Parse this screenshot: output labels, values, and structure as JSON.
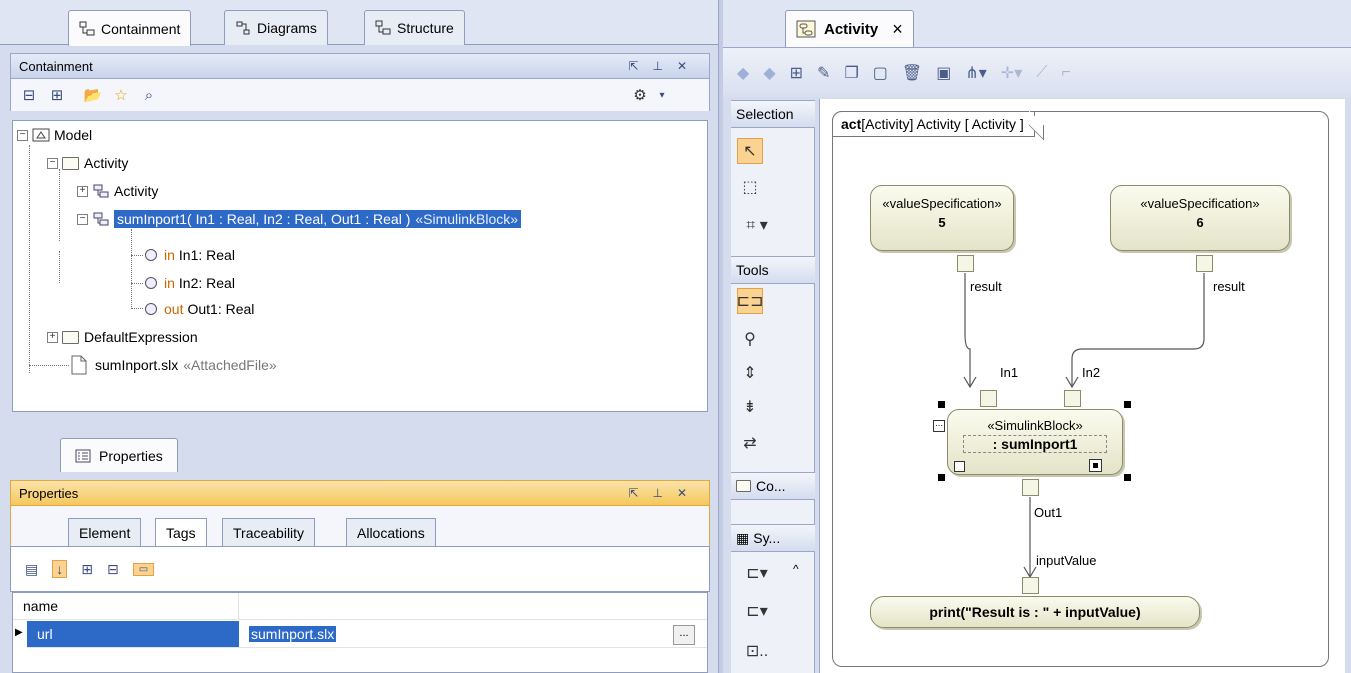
{
  "left_tabs": [
    {
      "label": "Containment",
      "active": true
    },
    {
      "label": "Diagrams",
      "active": false
    },
    {
      "label": "Structure",
      "active": false
    }
  ],
  "containment": {
    "title": "Containment",
    "tree": {
      "model": "Model",
      "activity_pkg": "Activity",
      "activity_item": "Activity",
      "sum_block": "sumInport1( In1 : Real, In2 : Real, Out1 : Real )",
      "sum_block_stereo": "«SimulinkBlock»",
      "params": [
        {
          "dir": "in",
          "name": "In1",
          "type": " : Real"
        },
        {
          "dir": "in",
          "name": "In2",
          "type": " : Real"
        },
        {
          "dir": "out",
          "name": "Out1",
          "type": " : Real"
        }
      ],
      "default_expr": "DefaultExpression",
      "file": "sumInport.slx",
      "file_stereo": "«AttachedFile»"
    }
  },
  "properties": {
    "tab_label": "Properties",
    "title": "Properties",
    "subtabs": [
      "Element",
      "Tags",
      "Traceability",
      "Allocations"
    ],
    "active_subtab": "Tags",
    "rows": [
      {
        "name": "name",
        "value": ""
      },
      {
        "name": "url",
        "value": "sumInport.slx"
      }
    ],
    "ellipsis": "..."
  },
  "diagram": {
    "tab_label": "Activity",
    "close": "×",
    "palette": {
      "selection": "Selection",
      "tools": "Tools",
      "co": "Co...",
      "sy": "Sy..."
    },
    "frame_label_kw": "act",
    "frame_label_rest": " [Activity] Activity [ Activity ]",
    "nodes": {
      "vs1": {
        "stereo": "«valueSpecification»",
        "value": "5"
      },
      "vs2": {
        "stereo": "«valueSpecification»",
        "value": "6"
      },
      "block": {
        "stereo": "«SimulinkBlock»",
        "name": ": sumInport1"
      },
      "print": "print(\"Result is : \" + inputValue)"
    },
    "pin_labels": {
      "result1": "result",
      "result2": "result",
      "in1": "In1",
      "in2": "In2",
      "out1": "Out1",
      "input_value": "inputValue"
    }
  },
  "colors": {
    "selection_blue": "#2d69c7",
    "keyword_orange": "#cc6600",
    "action_fill": "#f2f2dc",
    "properties_header": "#f5c85d"
  }
}
